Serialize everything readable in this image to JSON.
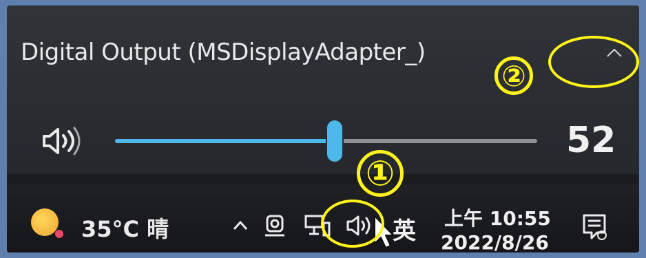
{
  "flyout": {
    "device_name": "Digital Output (MSDisplayAdapter_)",
    "volume_value": "52",
    "volume_level_percent": 52
  },
  "taskbar": {
    "weather": "35°C 晴",
    "ime": "英",
    "time": "上午 10:55",
    "date": "2022/8/26"
  },
  "annotations": {
    "one": "①",
    "two": "②",
    "color": "#fff31a"
  },
  "icons": {
    "collapse": "chevron-up-icon",
    "volume": "speaker-icon",
    "weather": "sun-icon",
    "tray_expand": "chevron-up-icon",
    "meet_now": "camera-icon",
    "network": "network-icon",
    "notifications": "notification-icon"
  },
  "colors": {
    "accent": "#4fb8ea",
    "annotation": "#fff31a"
  }
}
